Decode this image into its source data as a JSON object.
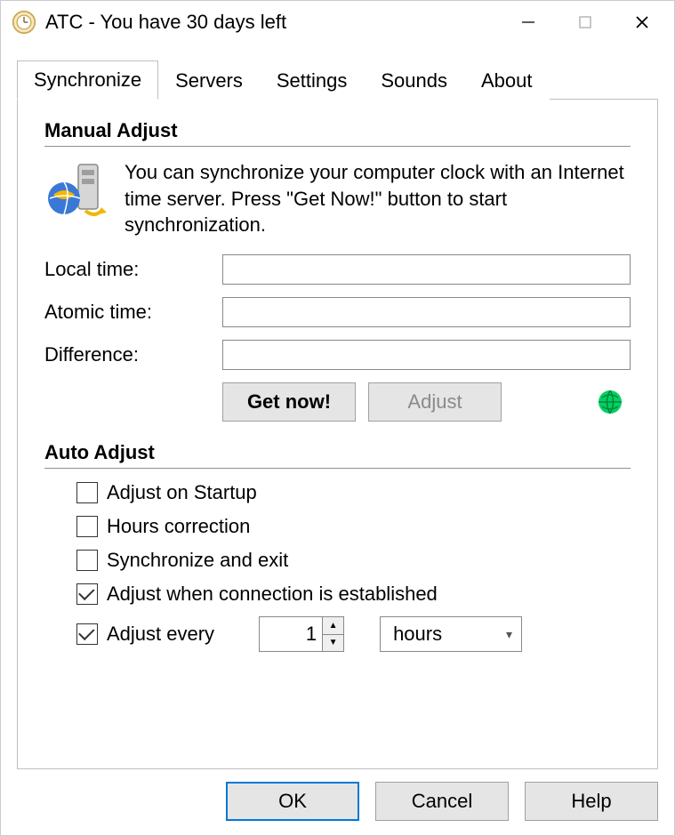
{
  "window": {
    "title": "ATC - You have 30 days left"
  },
  "tabs": [
    "Synchronize",
    "Servers",
    "Settings",
    "Sounds",
    "About"
  ],
  "manual": {
    "heading": "Manual Adjust",
    "description": "You can synchronize your computer clock with an Internet time server. Press \"Get Now!\" button to start synchronization.",
    "local_label": "Local time:",
    "atomic_label": "Atomic time:",
    "difference_label": "Difference:",
    "local_value": "",
    "atomic_value": "",
    "difference_value": "",
    "get_now": "Get now!",
    "adjust": "Adjust"
  },
  "auto": {
    "heading": "Auto Adjust",
    "cb_startup": "Adjust on Startup",
    "cb_hours": "Hours correction",
    "cb_sync_exit": "Synchronize and exit",
    "cb_conn": "Adjust when connection is established",
    "cb_every": "Adjust every",
    "every_value": "1",
    "every_unit": "hours"
  },
  "buttons": {
    "ok": "OK",
    "cancel": "Cancel",
    "help": "Help"
  }
}
